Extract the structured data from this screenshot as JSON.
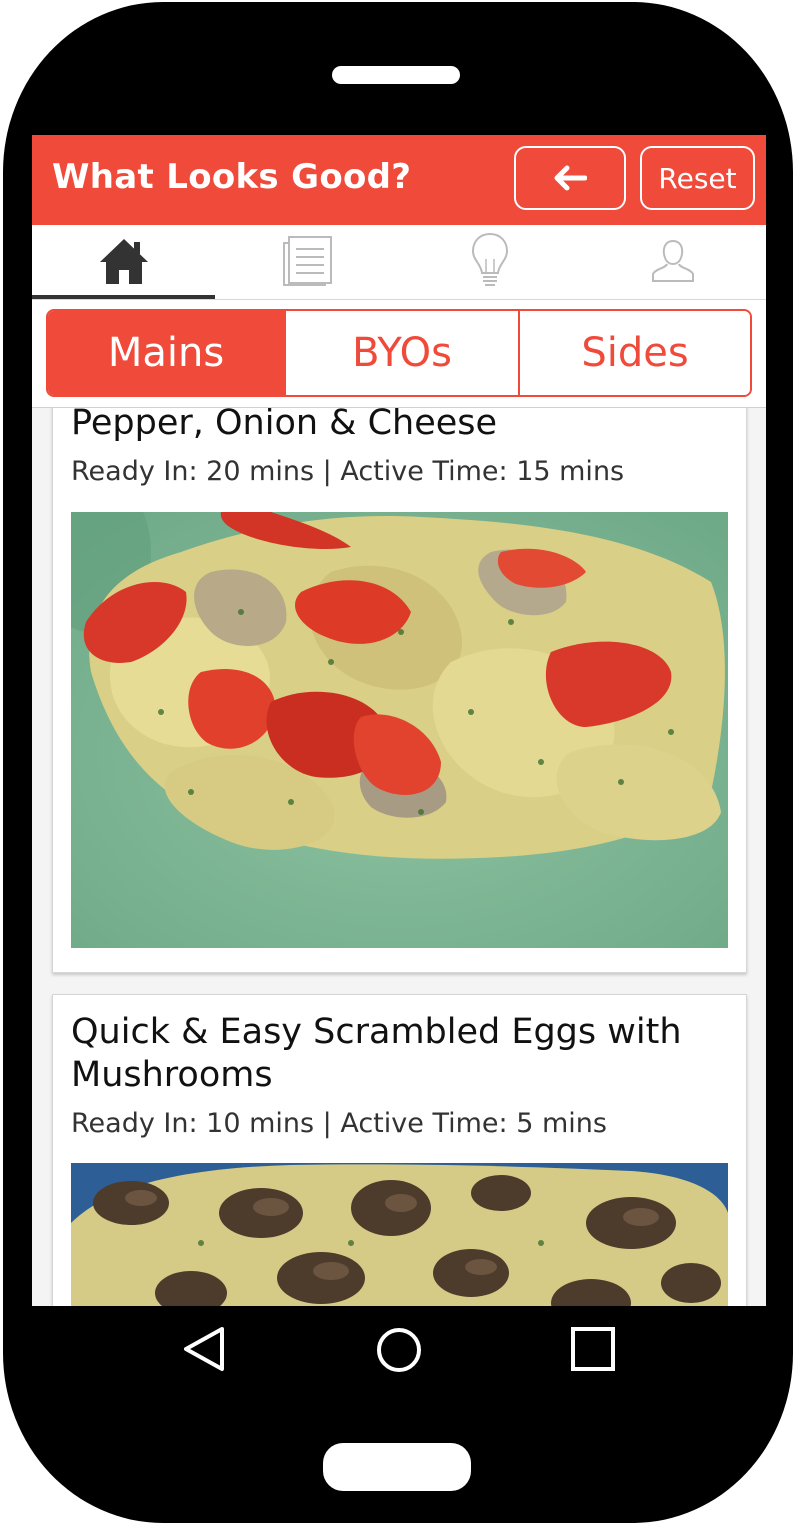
{
  "app": {
    "title": "What Looks Good?",
    "reset_label": "Reset",
    "accent_color": "#ef4a3a"
  },
  "icon_tabs": [
    {
      "name": "home-icon",
      "active": true
    },
    {
      "name": "list-icon",
      "active": false
    },
    {
      "name": "lightbulb-icon",
      "active": false
    },
    {
      "name": "profile-icon",
      "active": false
    }
  ],
  "segments": [
    {
      "label": "Mains",
      "active": true
    },
    {
      "label": "BYOs",
      "active": false
    },
    {
      "label": "Sides",
      "active": false
    }
  ],
  "recipes": [
    {
      "title": "Pepper, Onion & Cheese",
      "meta": "Ready In: 20 mins | Active Time: 15 mins",
      "image": "scrambled-eggs-peppers-photo"
    },
    {
      "title": "Quick & Easy Scrambled Eggs with Mushrooms",
      "meta": "Ready In: 10 mins | Active Time: 5 mins",
      "image": "scrambled-eggs-mushrooms-photo"
    }
  ],
  "system_nav": [
    "back-triangle-icon",
    "home-circle-icon",
    "recents-square-icon"
  ]
}
